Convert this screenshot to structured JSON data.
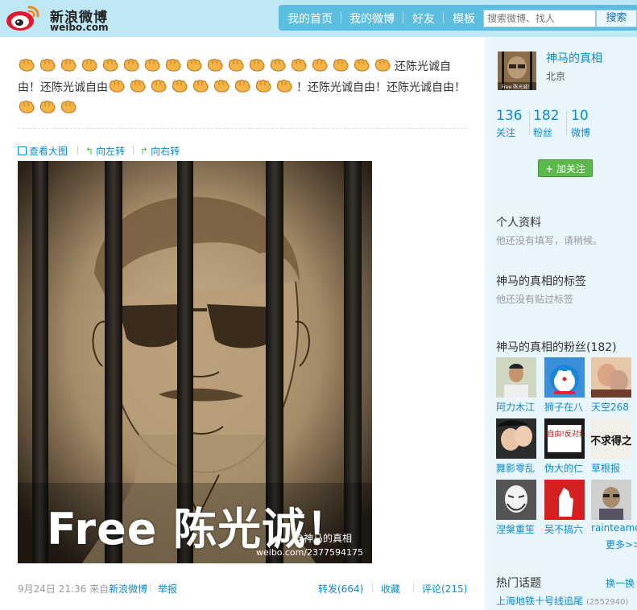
{
  "header": {
    "logo_cn": "新浪微博",
    "logo_en": "weibo.com",
    "nav": [
      "我的首页",
      "我的微博",
      "好友",
      "模板"
    ],
    "search_placeholder": "搜索微博、找人",
    "search_button": "搜索"
  },
  "post": {
    "line1_text": "还陈光诚自",
    "line2_a": "由！还陈光诚自由",
    "line2_b": "！还陈光诚自由！还陈光诚自由！",
    "fist_icon": "fist-emoji-icon",
    "tools": [
      "查看大图",
      "向左转",
      "向右转"
    ],
    "image": {
      "caption": "Free 陈光诚！",
      "watermark_user": "@神马的真相",
      "watermark_url": "weibo.com/2377594175"
    },
    "time": "9月24日 21:36",
    "source_prefix": "来自",
    "source": "新浪微博",
    "report": "举报",
    "repost": "转发(664)",
    "favorite": "收藏",
    "comment": "评论(215)"
  },
  "profile": {
    "name": "神马的真相",
    "location": "北京",
    "avatar_caption": "Free 陈光诚！",
    "stats": [
      {
        "num": "136",
        "label": "关注"
      },
      {
        "num": "182",
        "label": "粉丝"
      },
      {
        "num": "10",
        "label": "微博"
      }
    ],
    "follow_button": "+ 加关注",
    "info_title": "个人资料",
    "info_empty": "他还没有填写，请稍候。",
    "tags_title": "神马的真相的标签",
    "tags_empty": "他还没有贴过标签",
    "fans_title": "神马的真相的粉丝(182)",
    "fans": [
      "阿力木江",
      "狮子在八",
      "天空268",
      "舞影零乱",
      "伪大的仁",
      "草根报",
      "涅槃重笙",
      "吴不搞六",
      "rainteamo"
    ],
    "fan_sign_text": "言论自由!反对封号!",
    "fan_calligraphy": "不求得之",
    "more": "更多>>",
    "hot_title": "热门话题",
    "hot_switch": "换一换",
    "hot_topic": "上海地铁十号线追尾",
    "hot_count": "(2552940)"
  }
}
